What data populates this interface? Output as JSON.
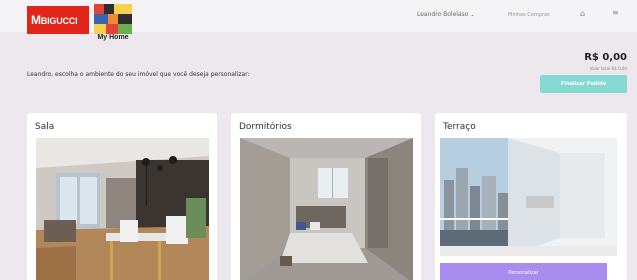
{
  "header": {
    "brand_prefix": "M",
    "brand_name": "BIGUCCI",
    "home_logo_caption": "My Home",
    "user_name": "Leandro Bolelaso",
    "user_caret": "⌄",
    "nav_link": "Minhas Compras",
    "home_icon": "⌂",
    "menu_icon": "≡"
  },
  "intro": {
    "prompt": "Leandro, escolha o ambiente do seu imóvel que você deseja personalizar:"
  },
  "summary": {
    "total": "R$ 0,00",
    "total_sub": "Valor total R$ 0,00",
    "finish_label": "Finalizar Pedido"
  },
  "rooms": [
    {
      "name": "Sala"
    },
    {
      "name": "Dormitórios"
    },
    {
      "name": "Terraço",
      "action_label": "Personalizar"
    }
  ],
  "colors": {
    "brand_red": "#e1251b",
    "accent_teal": "#86d9d0",
    "accent_purple": "#a78df0",
    "background": "#ece8ee"
  }
}
